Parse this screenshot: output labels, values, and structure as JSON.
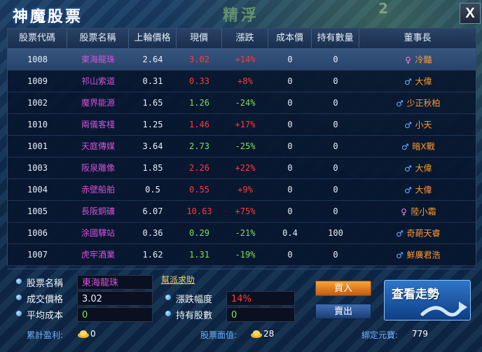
{
  "window": {
    "title": "神魔股票",
    "close_label": "X"
  },
  "background_text": [
    "精",
    "浮",
    "2"
  ],
  "table": {
    "headers": [
      "股票代碼",
      "股票名稱",
      "上輪價格",
      "現價",
      "漲跌",
      "成本價",
      "持有數量",
      "董事長"
    ],
    "rows": [
      {
        "code": "1008",
        "name": "東海龍珠",
        "prev": "2.64",
        "now": "3.02",
        "change": "+14%",
        "cost": "0",
        "qty": "0",
        "gender": "female",
        "director": "冷豔",
        "dir_symbol": "♀",
        "trend": "up",
        "selected": true
      },
      {
        "code": "1009",
        "name": "祁山索道",
        "prev": "0.31",
        "now": "0.33",
        "change": "+8%",
        "cost": "0",
        "qty": "0",
        "gender": "male",
        "director": "大偉",
        "dir_symbol": "♂",
        "trend": "up",
        "selected": false
      },
      {
        "code": "1002",
        "name": "魔界能源",
        "prev": "1.65",
        "now": "1.26",
        "change": "-24%",
        "cost": "0",
        "qty": "0",
        "gender": "male",
        "director": "少正秋柏",
        "dir_symbol": "♂",
        "trend": "down",
        "selected": false
      },
      {
        "code": "1010",
        "name": "兩儀客棧",
        "prev": "1.25",
        "now": "1.46",
        "change": "+17%",
        "cost": "0",
        "qty": "0",
        "gender": "male",
        "director": "小天",
        "dir_symbol": "♂",
        "trend": "up",
        "selected": false
      },
      {
        "code": "1001",
        "name": "天庭傳媒",
        "prev": "3.64",
        "now": "2.73",
        "change": "-25%",
        "cost": "0",
        "qty": "0",
        "gender": "male",
        "director": "暗X戰",
        "dir_symbol": "♂",
        "trend": "down",
        "selected": false
      },
      {
        "code": "1003",
        "name": "阪泉雕像",
        "prev": "1.85",
        "now": "2.26",
        "change": "+22%",
        "cost": "0",
        "qty": "0",
        "gender": "male",
        "director": "大偉",
        "dir_symbol": "♂",
        "trend": "up",
        "selected": false
      },
      {
        "code": "1004",
        "name": "赤壁船舶",
        "prev": "0.5",
        "now": "0.55",
        "change": "+9%",
        "cost": "0",
        "qty": "0",
        "gender": "male",
        "director": "大偉",
        "dir_symbol": "♂",
        "trend": "up",
        "selected": false
      },
      {
        "code": "1005",
        "name": "長阪銅礦",
        "prev": "6.07",
        "now": "10.63",
        "change": "+75%",
        "cost": "0",
        "qty": "0",
        "gender": "female",
        "director": "陸小霜",
        "dir_symbol": "♀",
        "trend": "up",
        "selected": false
      },
      {
        "code": "1006",
        "name": "涂國驛站",
        "prev": "0.36",
        "now": "0.29",
        "change": "-21%",
        "cost": "0.4",
        "qty": "100",
        "gender": "male",
        "director": "奇葩天睿",
        "dir_symbol": "♂",
        "trend": "down",
        "selected": false
      },
      {
        "code": "1007",
        "name": "虎牢酒業",
        "prev": "1.62",
        "now": "1.31",
        "change": "-19%",
        "cost": "0",
        "qty": "0",
        "gender": "male",
        "director": "鮮廣君浩",
        "dir_symbol": "♂",
        "trend": "down",
        "selected": false
      }
    ]
  },
  "detail": {
    "name_label": "股票名稱",
    "name_value": "東海龍珠",
    "price_label": "成交價格",
    "price_value": "3.02",
    "avg_label": "平均成本",
    "avg_value": "0",
    "aid_link": "幫派求助",
    "change_label": "漲跌幅度",
    "change_value": "14%",
    "holding_label": "持有股數",
    "holding_value": "0"
  },
  "actions": {
    "buy": "買入",
    "sell": "賣出",
    "trend": "查看走勢"
  },
  "footer": {
    "profit_label": "累計盈利:",
    "profit_value": "0",
    "value_label": "股票面值:",
    "value_value": "28",
    "bound_label": "綁定元寶:",
    "bound_value": "779"
  },
  "colors": {
    "up": "#ff3a3a",
    "down": "#7ee05a",
    "name": "#d252d8",
    "director": "#ff9a2e",
    "accent": "#2e76c8"
  }
}
